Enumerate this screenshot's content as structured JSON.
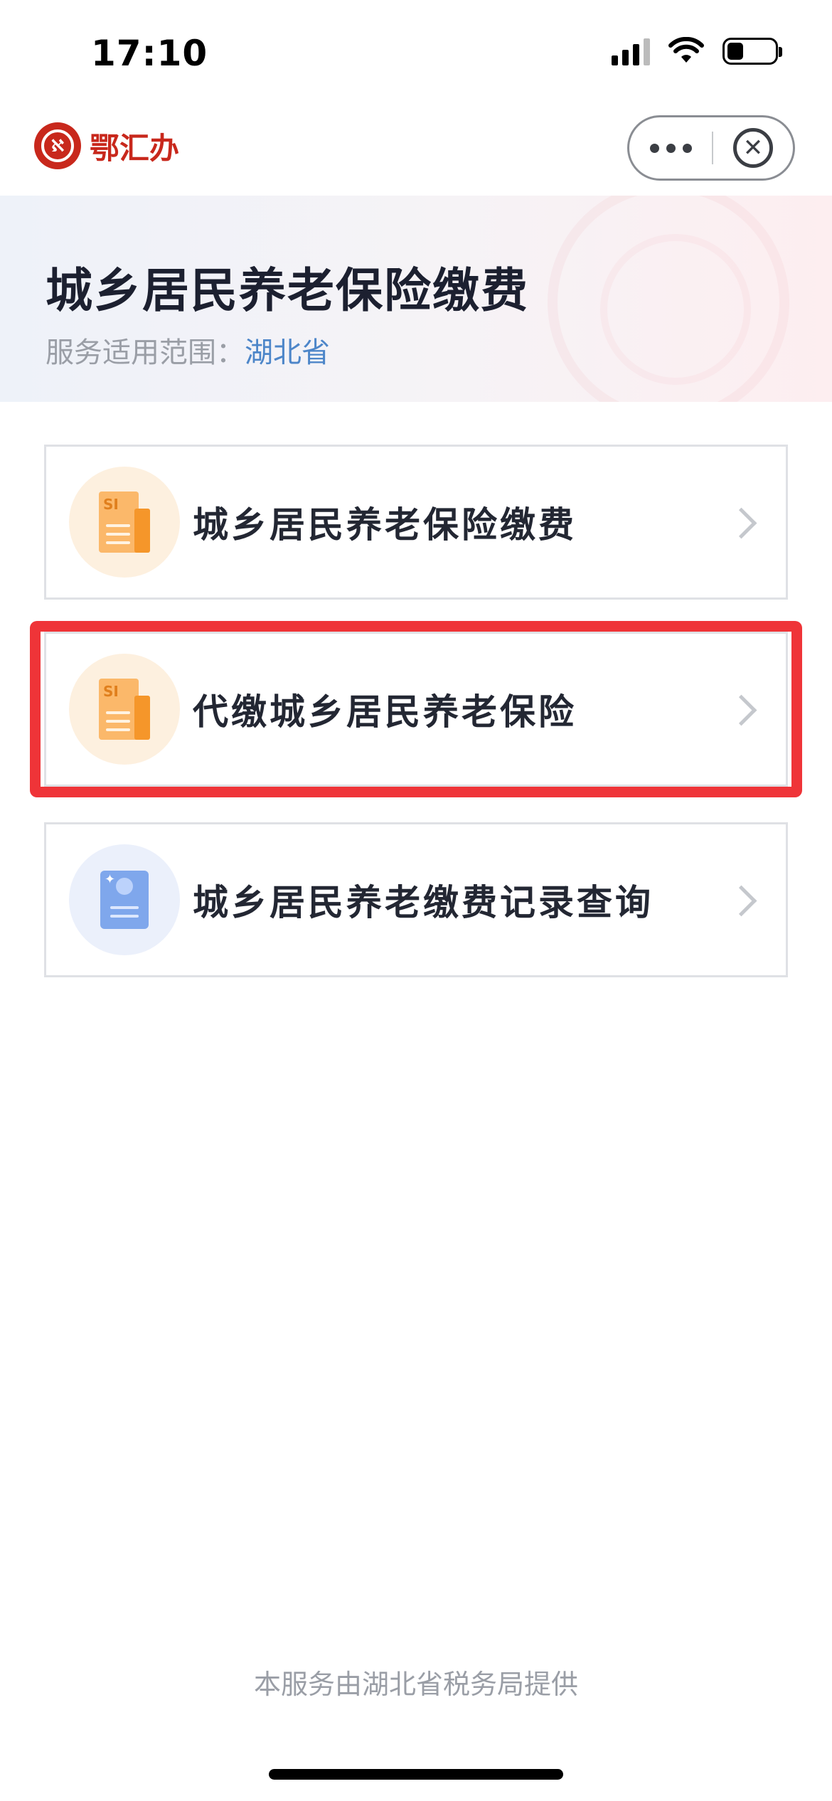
{
  "status_bar": {
    "time": "17:10",
    "battery_level": 0.34
  },
  "nav": {
    "logo_text": "鄂汇办",
    "logo_mark_text": "ℵ",
    "more_icon": "more-dots-icon",
    "close_icon": "close-circle-icon",
    "close_glyph": "✕"
  },
  "header": {
    "title": "城乡居民养老保险缴费",
    "scope_label": "服务适用范围：",
    "scope_value": "湖北省"
  },
  "services": [
    {
      "label": "城乡居民养老保险缴费",
      "icon": "social-insurance-doc-icon",
      "icon_text": "SI",
      "highlighted": false
    },
    {
      "label": "代缴城乡居民养老保险",
      "icon": "social-insurance-doc-icon",
      "icon_text": "SI",
      "highlighted": true
    },
    {
      "label": "城乡居民养老缴费记录查询",
      "icon": "record-book-icon",
      "icon_text": "✦",
      "highlighted": false
    }
  ],
  "footer": {
    "note": "本服务由湖北省税务局提供"
  },
  "colors": {
    "brand": "#c8281c",
    "highlight": "#ef3438",
    "scope_value": "#4d86c9",
    "orange_icon": "#fbb86a",
    "blue_icon": "#7fa7ec"
  }
}
